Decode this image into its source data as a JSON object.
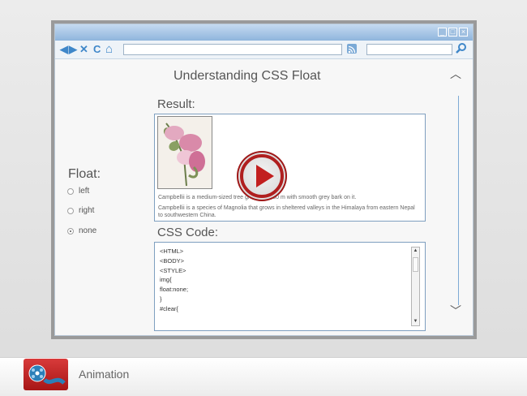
{
  "browser": {
    "window_buttons": [
      "_",
      "□",
      "×"
    ],
    "nav_icons": [
      "back-icon",
      "forward-icon",
      "stop-icon",
      "refresh-icon",
      "home-icon"
    ],
    "nav_glyphs": [
      "◀",
      "▶",
      "✕",
      "C",
      "⌂"
    ],
    "search_glyph": "⚲",
    "rss_icon": "rss-icon"
  },
  "page": {
    "title": "Understanding CSS Float",
    "float_label": "Float:",
    "options": [
      {
        "label": "left",
        "checked": false
      },
      {
        "label": "right",
        "checked": false
      },
      {
        "label": "none",
        "checked": true
      }
    ],
    "result_label": "Result:",
    "result_text_1": "Campbellii is a medium-sized tree growing to 30 m with smooth grey bark on it.",
    "result_text_2": "Campbellii is a species of Magnolia that grows in sheltered valleys in the Himalaya from eastern Nepal to southwestern China.",
    "css_label": "CSS Code:",
    "code_lines": [
      "<HTML>",
      "<BODY>",
      "<STYLE>",
      "img{",
      "float:none;",
      "}",
      "#clear{"
    ],
    "scroll_up": "▲",
    "scroll_down": "▼"
  },
  "chevrons": {
    "up": "︿",
    "down": "﹀"
  },
  "player": {
    "play_icon": "play-icon"
  },
  "footer": {
    "label": "Animation"
  },
  "colors": {
    "accent": "#3f87c9",
    "play_red": "#c21f1f",
    "title_bar": "#8fb5dd"
  }
}
